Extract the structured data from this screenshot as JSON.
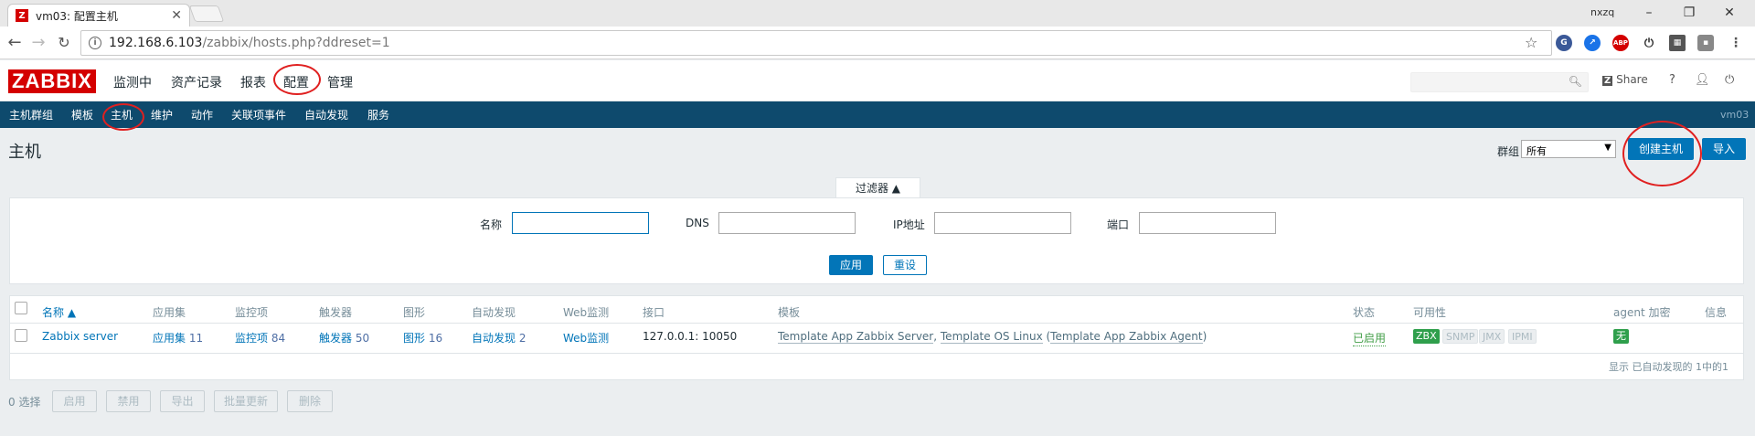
{
  "browser": {
    "tab_icon": "Z",
    "tab_title": "vm03: 配置主机",
    "tab_close": "✕",
    "user_badge": "nxzq",
    "url_host": "192.168.6.103",
    "url_path": "/zabbix/hosts.php?ddreset=1"
  },
  "header": {
    "logo": "ZABBIX",
    "menu": [
      "监测中",
      "资产记录",
      "报表",
      "配置",
      "管理"
    ],
    "share": "Share",
    "help": "?"
  },
  "subnav": {
    "items": [
      "主机群组",
      "模板",
      "主机",
      "维护",
      "动作",
      "关联项事件",
      "自动发现",
      "服务"
    ],
    "server": "vm03"
  },
  "page": {
    "title": "主机",
    "group_label": "群组",
    "group_value": "所有",
    "create_button": "创建主机",
    "import_button": "导入"
  },
  "filter": {
    "tab": "过滤器 ▲",
    "name_label": "名称",
    "dns_label": "DNS",
    "ip_label": "IP地址",
    "port_label": "端口",
    "apply": "应用",
    "reset": "重设"
  },
  "table": {
    "headers": [
      "名称 ▲",
      "应用集",
      "监控项",
      "触发器",
      "图形",
      "自动发现",
      "Web监测",
      "接口",
      "模板",
      "状态",
      "可用性",
      "agent 加密",
      "信息"
    ],
    "row": {
      "name": "Zabbix server",
      "apps": "应用集",
      "apps_count": "11",
      "items": "监控项",
      "items_count": "84",
      "triggers": "触发器",
      "triggers_count": "50",
      "graphs": "图形",
      "graphs_count": "16",
      "discovery": "自动发现",
      "discovery_count": "2",
      "web": "Web监测",
      "interface": "127.0.0.1: 10050",
      "tpl1": "Template App Zabbix Server",
      "tpl2": "Template OS Linux",
      "tpl3": "Template App Zabbix Agent",
      "status": "已启用",
      "avail": [
        "ZBX",
        "SNMP",
        "JMX",
        "IPMI"
      ],
      "encryption": "无"
    },
    "footer": "显示 已自动发现的 1中的1"
  },
  "actions": {
    "selected": "0 选择",
    "buttons": [
      "启用",
      "禁用",
      "导出",
      "批量更新",
      "删除"
    ]
  },
  "colors": {
    "brand": "#d40000",
    "nav": "#0e4a6d",
    "primary": "#0275b8",
    "ok": "#429e47",
    "annotation": "#e02020"
  }
}
